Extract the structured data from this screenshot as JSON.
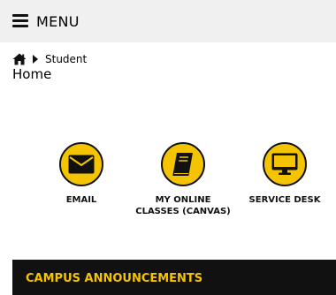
{
  "header": {
    "menu_label": "MENU"
  },
  "breadcrumb": {
    "current": "Student"
  },
  "page": {
    "title": "Home"
  },
  "tiles": [
    {
      "label": "EMAIL",
      "icon": "envelope-icon"
    },
    {
      "label": "MY ONLINE CLASSES (CANVAS)",
      "icon": "book-icon"
    },
    {
      "label": "SERVICE DESK",
      "icon": "monitor-icon"
    }
  ],
  "announcements": {
    "title": "CAMPUS ANNOUNCEMENTS"
  },
  "colors": {
    "accent": "#f5c400",
    "dark": "#111111",
    "menu_bg": "#f0f0f0"
  }
}
